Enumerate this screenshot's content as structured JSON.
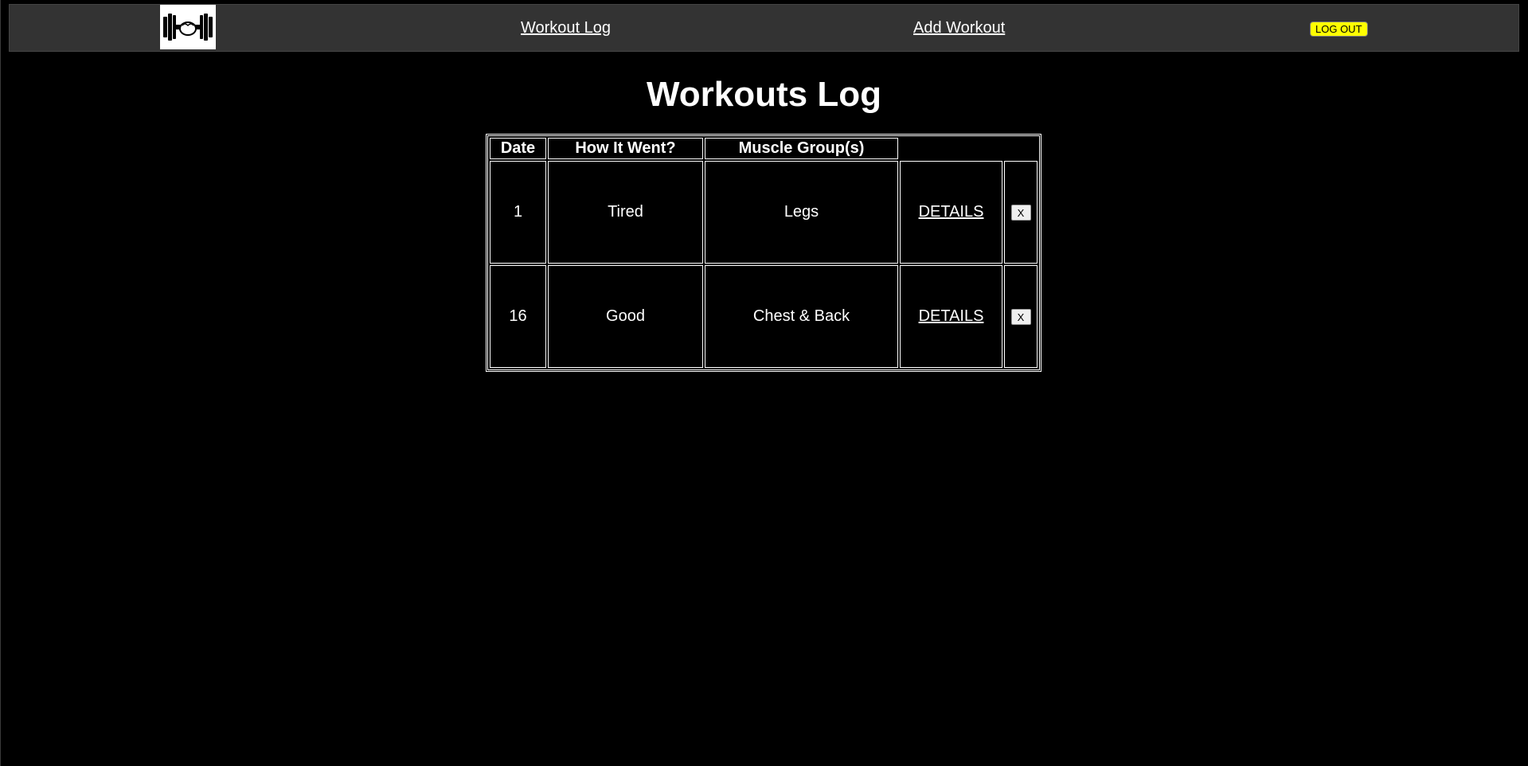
{
  "nav": {
    "logo_icon": "dumbbell-icon",
    "workout_log_label": "Workout Log",
    "add_workout_label": "Add Workout",
    "logout_label": "LOG OUT",
    "logout_color": "#ffff00"
  },
  "page": {
    "title": "Workouts Log"
  },
  "table": {
    "headers": [
      "Date",
      "How It Went?",
      "Muscle Group(s)"
    ],
    "rows": [
      {
        "date": "1",
        "how": "Tired",
        "muscle": "Legs",
        "details": "DETAILS",
        "delete": "X"
      },
      {
        "date": "16",
        "how": "Good",
        "muscle": "Chest & Back",
        "details": "DETAILS",
        "delete": "X"
      }
    ]
  }
}
